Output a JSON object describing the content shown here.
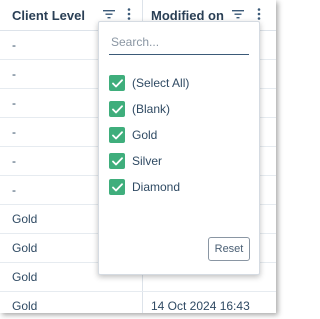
{
  "columns": {
    "client_level": {
      "header": "Client Level",
      "filter_icon": "filter-icon",
      "menu_icon": "vertical-dots-icon"
    },
    "modified_on": {
      "header": "Modified on",
      "filter_icon": "filter-icon",
      "menu_icon": "vertical-dots-icon"
    }
  },
  "rows": [
    {
      "client_level": "-",
      "modified_on": ""
    },
    {
      "client_level": "-",
      "modified_on": ""
    },
    {
      "client_level": "-",
      "modified_on": ""
    },
    {
      "client_level": "-",
      "modified_on": ""
    },
    {
      "client_level": "-",
      "modified_on": ""
    },
    {
      "client_level": "-",
      "modified_on": ""
    },
    {
      "client_level": "Gold",
      "modified_on": ""
    },
    {
      "client_level": "Gold",
      "modified_on": ""
    },
    {
      "client_level": "Gold",
      "modified_on": ""
    },
    {
      "client_level": "Gold",
      "modified_on": "14 Oct 2024 16:43"
    }
  ],
  "filter_popup": {
    "search_placeholder": "Search...",
    "search_value": "",
    "options": [
      {
        "label": "(Select All)",
        "checked": true
      },
      {
        "label": "(Blank)",
        "checked": true
      },
      {
        "label": "Gold",
        "checked": true
      },
      {
        "label": "Silver",
        "checked": true
      },
      {
        "label": "Diamond",
        "checked": true
      }
    ],
    "reset_label": "Reset"
  },
  "colors": {
    "checkbox_checked": "#3fae7c",
    "text": "#2f4a63",
    "header_text": "#2a3f55"
  }
}
